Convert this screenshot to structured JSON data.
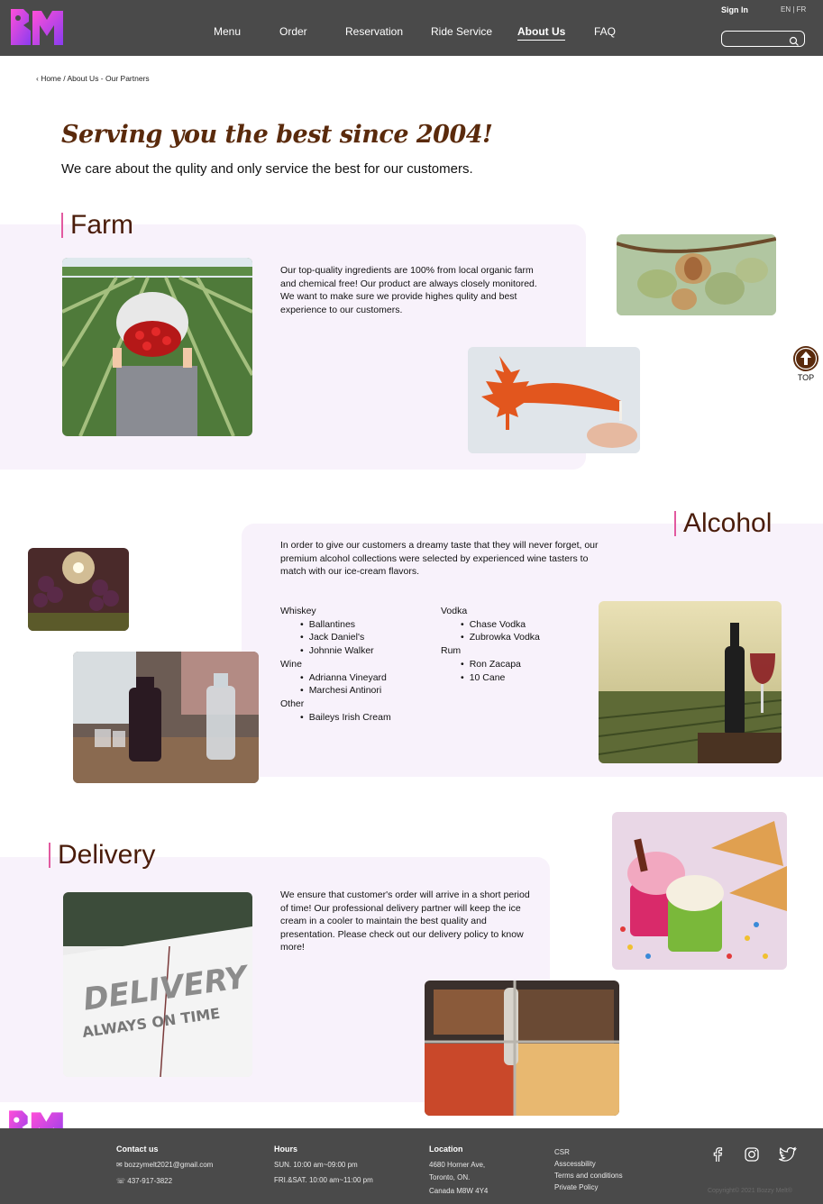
{
  "header": {
    "logo_alt": "BM",
    "nav": [
      "Menu",
      "Order",
      "Reservation",
      "Ride Service",
      "About Us",
      "FAQ"
    ],
    "active_nav": "About Us",
    "signin": "Sign In",
    "lang": "EN | FR",
    "search_placeholder": ""
  },
  "breadcrumb": "‹ Home / About Us - Our Partners",
  "hero": {
    "title": "Serving you the best since 2004!",
    "subtitle": "We care about the qulity and only service the best for our customers."
  },
  "farm": {
    "title": "Farm",
    "text": "Our top-quality ingredients are 100% from local organic farm and chemical free!  Our product are always closely monitored. We want to make sure we provide highes qulity and best experience to our customers."
  },
  "alcohol": {
    "title": "Alcohol",
    "text": " In order to give our customers a dreamy taste that they will never forget, our premium alcohol collections were selected by experienced wine tasters to match with our ice-cream flavors.",
    "col1": [
      {
        "group": "Whiskey",
        "items": [
          "Ballantines",
          "Jack Daniel's",
          "Johnnie Walker"
        ]
      },
      {
        "group": "Wine",
        "items": [
          "Adrianna Vineyard",
          "Marchesi Antinori"
        ]
      },
      {
        "group": "Other",
        "items": [
          "Baileys Irish Cream"
        ]
      }
    ],
    "col2": [
      {
        "group": "Vodka",
        "items": [
          "Chase Vodka",
          "Zubrowka Vodka"
        ]
      },
      {
        "group": "Rum",
        "items": [
          "Ron Zacapa",
          "10 Cane"
        ]
      }
    ]
  },
  "delivery": {
    "title": "Delivery",
    "text": "We ensure that customer's order will arrive in a short period of time! Our professional delivery partner will keep the ice cream in a cooler to maintain the best quality and presentation. Please check out our delivery policy to know more!",
    "van_text_1": "DELIVERY",
    "van_text_2": "ALWAYS ON TIME"
  },
  "top_button": "TOP",
  "footer": {
    "contact_head": "Contact us",
    "email": "bozzymelt2021@gmail.com",
    "phone": "437-917-3822",
    "hours_head": "Hours",
    "hours_1": "SUN. 10:00 am~09:00 pm",
    "hours_2": "FRI.&SAT. 10:00 am~11:00 pm",
    "location_head": "Location",
    "loc_1": "4680 Horner Ave,",
    "loc_2": "Toronto, ON.",
    "loc_3": "Canada M8W 4Y4",
    "links": [
      "CSR",
      "Asscessbility",
      "Terms and conditions",
      "Private Policy"
    ],
    "copyright": "Copyright© 2021 Bozzy Melt®"
  },
  "colors": {
    "header_bg": "#4a4a4a",
    "accent_brown": "#5a2a0c",
    "panel_bg": "#f8f2fb",
    "title_bar": "#e25aa0"
  }
}
